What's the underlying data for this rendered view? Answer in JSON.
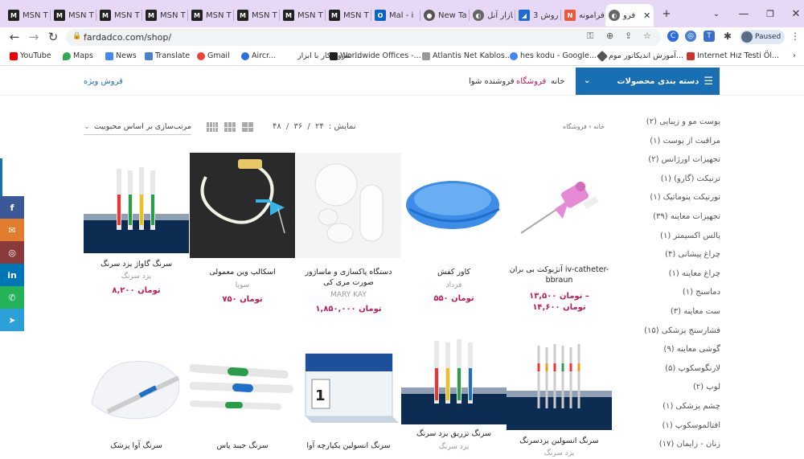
{
  "browser": {
    "tabs": [
      {
        "title": "MSN T",
        "icon": "msn-icon"
      },
      {
        "title": "MSN T",
        "icon": "msn-icon"
      },
      {
        "title": "MSN T",
        "icon": "msn-icon"
      },
      {
        "title": "MSN T",
        "icon": "msn-icon"
      },
      {
        "title": "MSN T",
        "icon": "msn-icon"
      },
      {
        "title": "MSN T",
        "icon": "msn-icon"
      },
      {
        "title": "MSN T",
        "icon": "msn-icon"
      },
      {
        "title": "MSN T",
        "icon": "msn-icon"
      },
      {
        "title": "Mal - i",
        "icon": "outlook-icon"
      },
      {
        "title": "New Ta",
        "icon": "chrome-icon"
      },
      {
        "title": "بازار آنل",
        "icon": "globe-icon"
      },
      {
        "title": "3 روش",
        "icon": "bookmark-icon"
      },
      {
        "title": "فرامونه",
        "icon": "n-icon"
      },
      {
        "title": "فرو",
        "icon": "globe-icon",
        "active": true
      }
    ],
    "url": "fardadco.com/shop/",
    "profile_status": "Paused",
    "bookmarks": [
      "YouTube",
      "Maps",
      "News",
      "Translate",
      "Gmail",
      "Aircr...",
      "شروع کار با ابزار ...",
      "Worldwide Offices -...",
      "Atlantis Net Kablos...",
      "hes kodu - Google...",
      "آموزش اندیکاتور موم...",
      "Internet Hız Testi Öl..."
    ]
  },
  "header": {
    "categories_label": "دسته بندی محصولات",
    "nav": [
      "خانه",
      "فروشگاه",
      "فروشنده شوا"
    ],
    "special_sale": "فروش ویژه"
  },
  "shop": {
    "breadcrumb": "خانه › فروشگاه",
    "showing_label": "نمایش :",
    "per_page": [
      "۲۴",
      "۳۶",
      "۴۸"
    ],
    "sort_label": "مرتب‌سازی بر اساس محبوبیت"
  },
  "sidebar": {
    "categories": [
      "پوست مو و زیبایی (۲)",
      "مراقبت از پوست (۱)",
      "تجهیزات اورژانس (۲)",
      "ترنیکت (گارو) (۱)",
      "تورنیکت پنوماتیک (۱)",
      "تجهیزات معاینه (۳۹)",
      "پالس اکسیمتر (۱)",
      "چراغ پیشانی (۴)",
      "چراغ معاینه (۱)",
      "دماسنج (۱)",
      "ست معاینه (۳)",
      "فشارسنج پزشکی (۱۵)",
      "گوشی معاینه (۹)",
      "لارنگوسکوپ (۵)",
      "لوپ (۲)",
      "چشم پزشکی (۱)",
      "افتالموسکوپ (۱)",
      "زنان - زایمان (۱۷)"
    ]
  },
  "social": [
    {
      "name": "facebook",
      "glyph": "f",
      "color": "#3b5998"
    },
    {
      "name": "email",
      "glyph": "✉",
      "color": "#e27d2e"
    },
    {
      "name": "instagram",
      "glyph": "◎",
      "color": "#8a3a3a"
    },
    {
      "name": "linkedin",
      "glyph": "in",
      "color": "#0077b5"
    },
    {
      "name": "whatsapp",
      "glyph": "✆",
      "color": "#25b35a"
    },
    {
      "name": "telegram",
      "glyph": "➤",
      "color": "#2ba0d8"
    }
  ],
  "products_row1": [
    {
      "name": "آنژیوکت بی بران iv-catheter-bbraun",
      "brand": "",
      "price": "۱۳,۵۰۰ تومان –\n۱۴,۶۰۰ تومان",
      "image": "iv-catheter"
    },
    {
      "name": "کاور کفش",
      "brand": "فرداد",
      "price": "۵۵۰ تومان",
      "image": "shoe-cover"
    },
    {
      "name": "دستگاه پاکسازی و ماساژور صورت مری کی",
      "brand": "MARY KAY",
      "price": "۱,۸۵۰,۰۰۰ تومان",
      "image": "face-massager"
    },
    {
      "name": "اسکالپ وین معمولی",
      "brand": "سوپا",
      "price": "۷۵۰ تومان",
      "image": "scalp-vein"
    },
    {
      "name": "سرنگ گاواژ یزد سرنگ",
      "brand": "یزد سرنگ",
      "price": "۸,۲۰۰ تومان",
      "image": "syringe-stand"
    }
  ],
  "products_row2": [
    {
      "name": "سرنگ انسولین یزدسرنگ",
      "brand": "یزد سرنگ",
      "image": "insulin-syringes"
    },
    {
      "name": "سرنگ تزریق یزد سرنگ",
      "brand": "یزد سرنگ",
      "image": "syringe-stand"
    },
    {
      "name": "سرنگ انسولین یکپارچه آوا",
      "brand": "",
      "image": "ava-box"
    },
    {
      "name": "سرنگ جیبد پاس",
      "brand": "",
      "image": "loose-syringes"
    },
    {
      "name": "سرنگ آوا پزشک",
      "brand": "",
      "image": "gloved-hand"
    }
  ]
}
